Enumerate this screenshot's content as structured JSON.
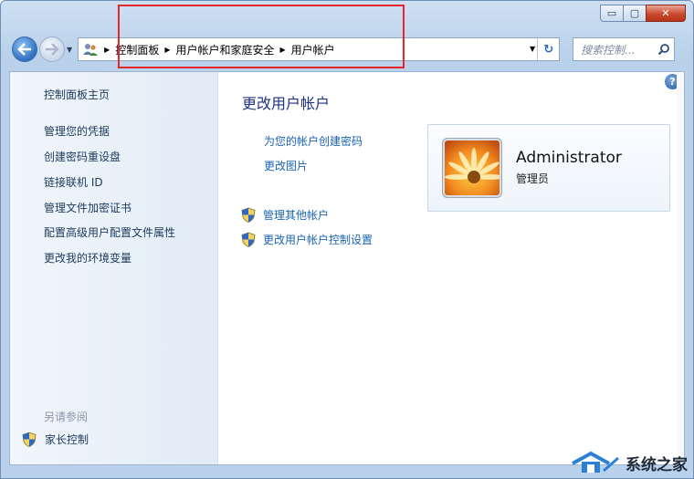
{
  "window": {
    "caption_buttons": {
      "minimize": "▭",
      "maximize": "▢",
      "close": "✕"
    }
  },
  "nav": {
    "back_icon": "back-arrow-icon",
    "forward_icon": "forward-arrow-icon"
  },
  "address": {
    "breadcrumbs": [
      "控制面板",
      "用户帐户和家庭安全",
      "用户帐户"
    ],
    "refresh_glyph": "↻"
  },
  "search": {
    "placeholder": "搜索控制..."
  },
  "sidebar": {
    "home": "控制面板主页",
    "links": [
      "管理您的凭据",
      "创建密码重设盘",
      "链接联机 ID",
      "管理文件加密证书",
      "配置高级用户配置文件属性",
      "更改我的环境变量"
    ],
    "see_also": "另请参阅",
    "parental_control": "家长控制"
  },
  "main": {
    "help": "?",
    "title": "更改用户帐户",
    "tasks": [
      "为您的帐户创建密码",
      "更改图片"
    ],
    "shield_tasks": [
      "管理其他帐户",
      "更改用户帐户控制设置"
    ]
  },
  "user": {
    "name": "Administrator",
    "role": "管理员"
  },
  "watermark": {
    "text": "系统之家"
  },
  "colors": {
    "link": "#1a63b3",
    "title": "#1e3287",
    "highlight": "#e5272d"
  }
}
